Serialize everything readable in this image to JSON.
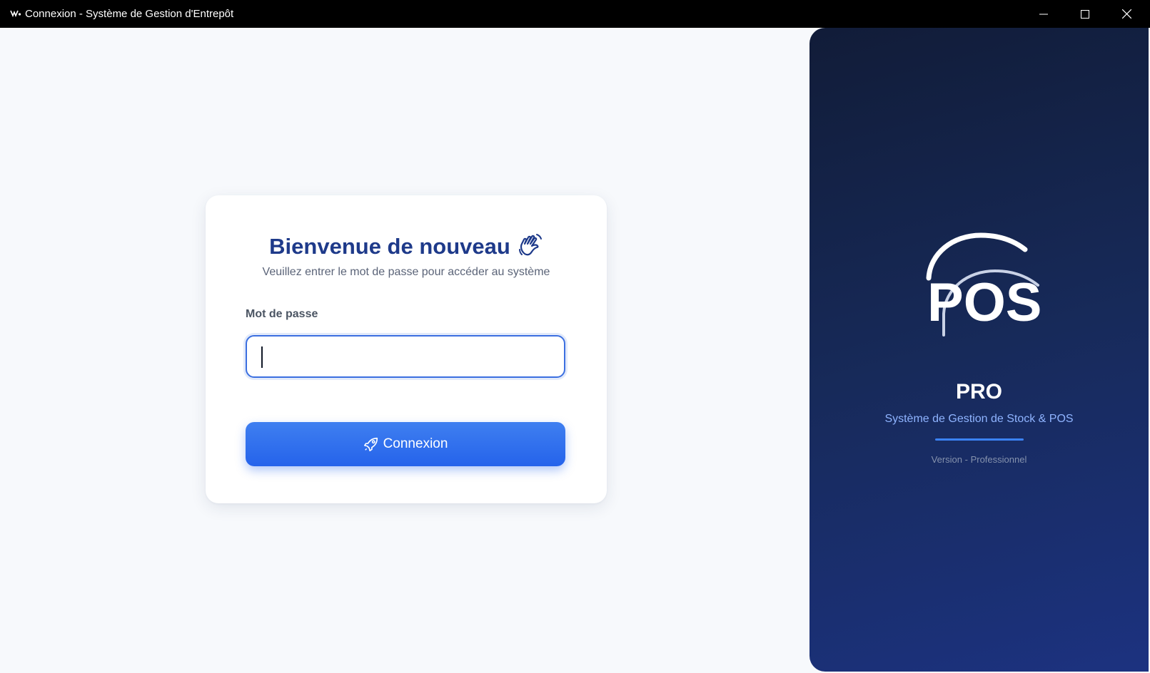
{
  "window": {
    "title": "Connexion - Système de Gestion d'Entrepôt",
    "controls": [
      "minimize-icon",
      "maximize-icon",
      "close-icon"
    ]
  },
  "login_card": {
    "heading": "Bienvenue de nouveau",
    "heading_icon": "waving-hand-icon",
    "subtitle": "Veuillez entrer le mot de passe pour accéder au système",
    "password_label": "Mot de passe",
    "password_value": "",
    "password_placeholder": "",
    "button_icon": "rocket-icon",
    "button_label": "Connexion"
  },
  "brand_panel": {
    "logo_text": "POS",
    "product_name": "PRO",
    "tagline": "Système de Gestion de Stock & POS",
    "version": "Version - Professionnel"
  },
  "colors": {
    "titlebar": "#000000",
    "page_background": "#f7f9fc",
    "heading": "#1e3a8a",
    "accent": "#2563eb",
    "panel_top": "#111c38",
    "panel_bottom": "#1c3280",
    "tagline": "#8fb4ff"
  }
}
